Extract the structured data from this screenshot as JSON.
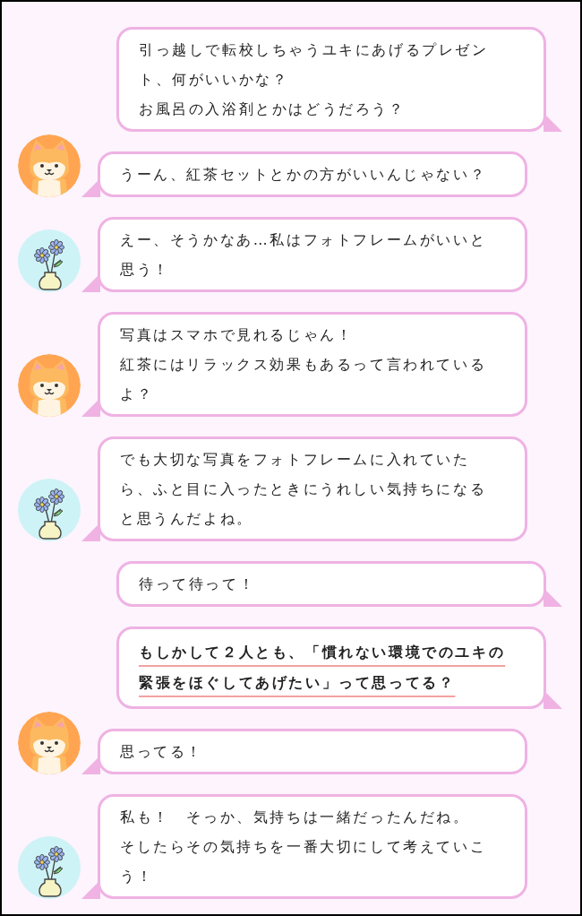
{
  "messages": [
    {
      "kind": "self",
      "emphasis": false,
      "lines": [
        "引っ越しで転校しちゃうユキにあげるプレゼント、何がいいかな？",
        "お風呂の入浴剤とかはどうだろう？"
      ]
    },
    {
      "kind": "dog",
      "emphasis": false,
      "lines": [
        "うーん、紅茶セットとかの方がいいんじゃない？"
      ]
    },
    {
      "kind": "flower",
      "emphasis": false,
      "lines": [
        "えー、そうかなあ…私はフォトフレームがいいと思う！"
      ]
    },
    {
      "kind": "dog",
      "emphasis": false,
      "lines": [
        "写真はスマホで見れるじゃん！",
        "紅茶にはリラックス効果もあるって言われているよ？"
      ]
    },
    {
      "kind": "flower",
      "emphasis": false,
      "lines": [
        "でも大切な写真をフォトフレームに入れていたら、ふと目に入ったときにうれしい気持ちになると思うんだよね。"
      ]
    },
    {
      "kind": "self",
      "emphasis": false,
      "lines": [
        "待って待って！"
      ]
    },
    {
      "kind": "self",
      "emphasis": true,
      "lines": [
        "もしかして２人とも、「慣れない環境でのユキの緊張をほぐしてあげたい」って思ってる？"
      ]
    },
    {
      "kind": "dog",
      "emphasis": false,
      "lines": [
        "思ってる！"
      ]
    },
    {
      "kind": "flower",
      "emphasis": false,
      "lines": [
        "私も！　そっか、気持ちは一緒だったんだね。",
        "そしたらその気持ちを一番大切にして考えていこう！"
      ]
    }
  ]
}
